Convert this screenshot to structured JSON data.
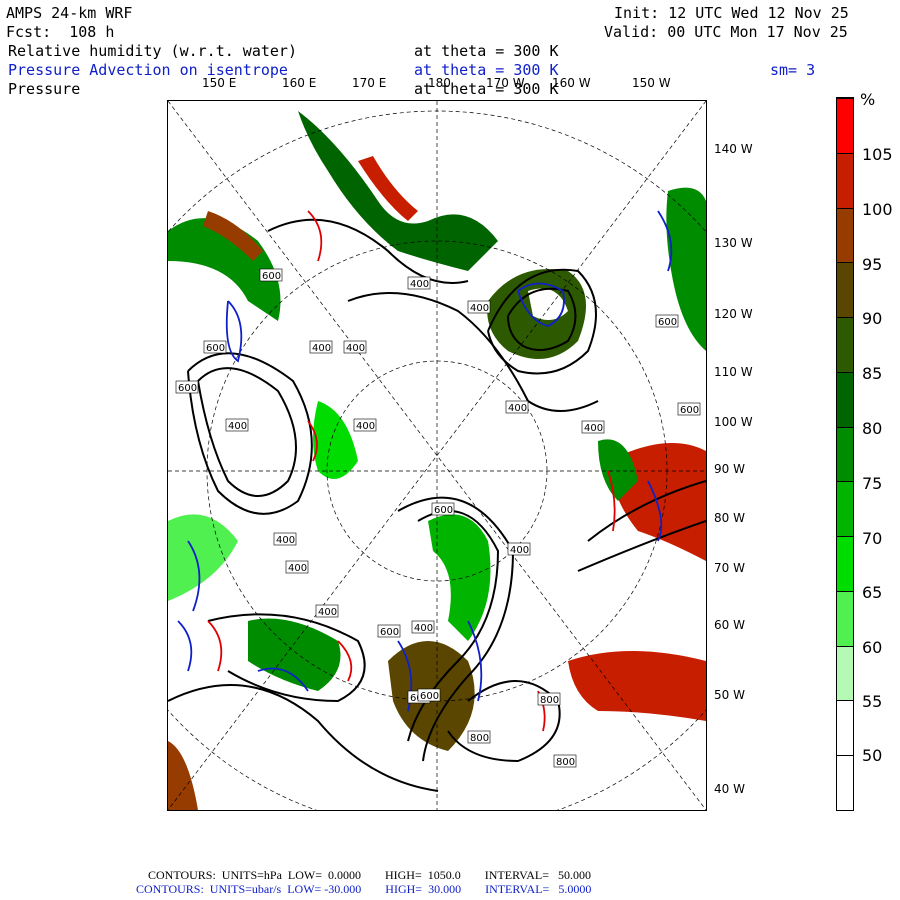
{
  "header": {
    "model": "AMPS 24-km WRF",
    "forecast": "Fcst:  108 h",
    "init": "Init: 12 UTC Wed 12 Nov 25",
    "valid": "Valid: 00 UTC Mon 17 Nov 25"
  },
  "fields": [
    {
      "name": "Relative humidity (w.r.t. water)",
      "level": "at theta = 300 K",
      "color": "#000000"
    },
    {
      "name": "Pressure Advection on isentrope",
      "level": "at theta = 300 K",
      "color": "#1020c8",
      "extra": "sm= 3"
    },
    {
      "name": "Pressure",
      "level": "at theta = 300 K",
      "color": "#000000"
    }
  ],
  "top_longitudes": [
    "150 E",
    "160 E",
    "170 E",
    "180",
    "170 W",
    "160 W",
    "150 W"
  ],
  "right_longitudes": [
    "140 W",
    "130 W",
    "120 W",
    "110 W",
    "100 W",
    "90 W",
    "80 W",
    "70 W",
    "60 W",
    "50 W",
    "40 W"
  ],
  "colorbar": {
    "unit": "%",
    "labels": [
      "105",
      "100",
      "95",
      "90",
      "85",
      "80",
      "75",
      "70",
      "65",
      "60",
      "55",
      "50"
    ],
    "colors": [
      "#ff0000",
      "#c81e00",
      "#963c00",
      "#5a4600",
      "#2d5a00",
      "#006400",
      "#008c00",
      "#00b400",
      "#00dc00",
      "#50f050",
      "#b4fab4",
      "#ffffff",
      "#ffffff"
    ]
  },
  "contour_labels": [
    "600",
    "600",
    "600",
    "600",
    "400",
    "400",
    "400",
    "400",
    "400",
    "400",
    "400",
    "400",
    "600",
    "600",
    "400",
    "400",
    "400",
    "400",
    "400",
    "600",
    "600",
    "600",
    "800",
    "800",
    "800"
  ],
  "footer": {
    "line1": "CONTOURS:  UNITS=hPa  LOW=  0.0000        HIGH=  1050.0        INTERVAL=   50.000",
    "line2": "CONTOURS:  UNITS=ubar/s  LOW= -30.000        HIGH=  30.000        INTERVAL=   5.0000",
    "line1_color": "#000000",
    "line2_color": "#1020c8"
  }
}
